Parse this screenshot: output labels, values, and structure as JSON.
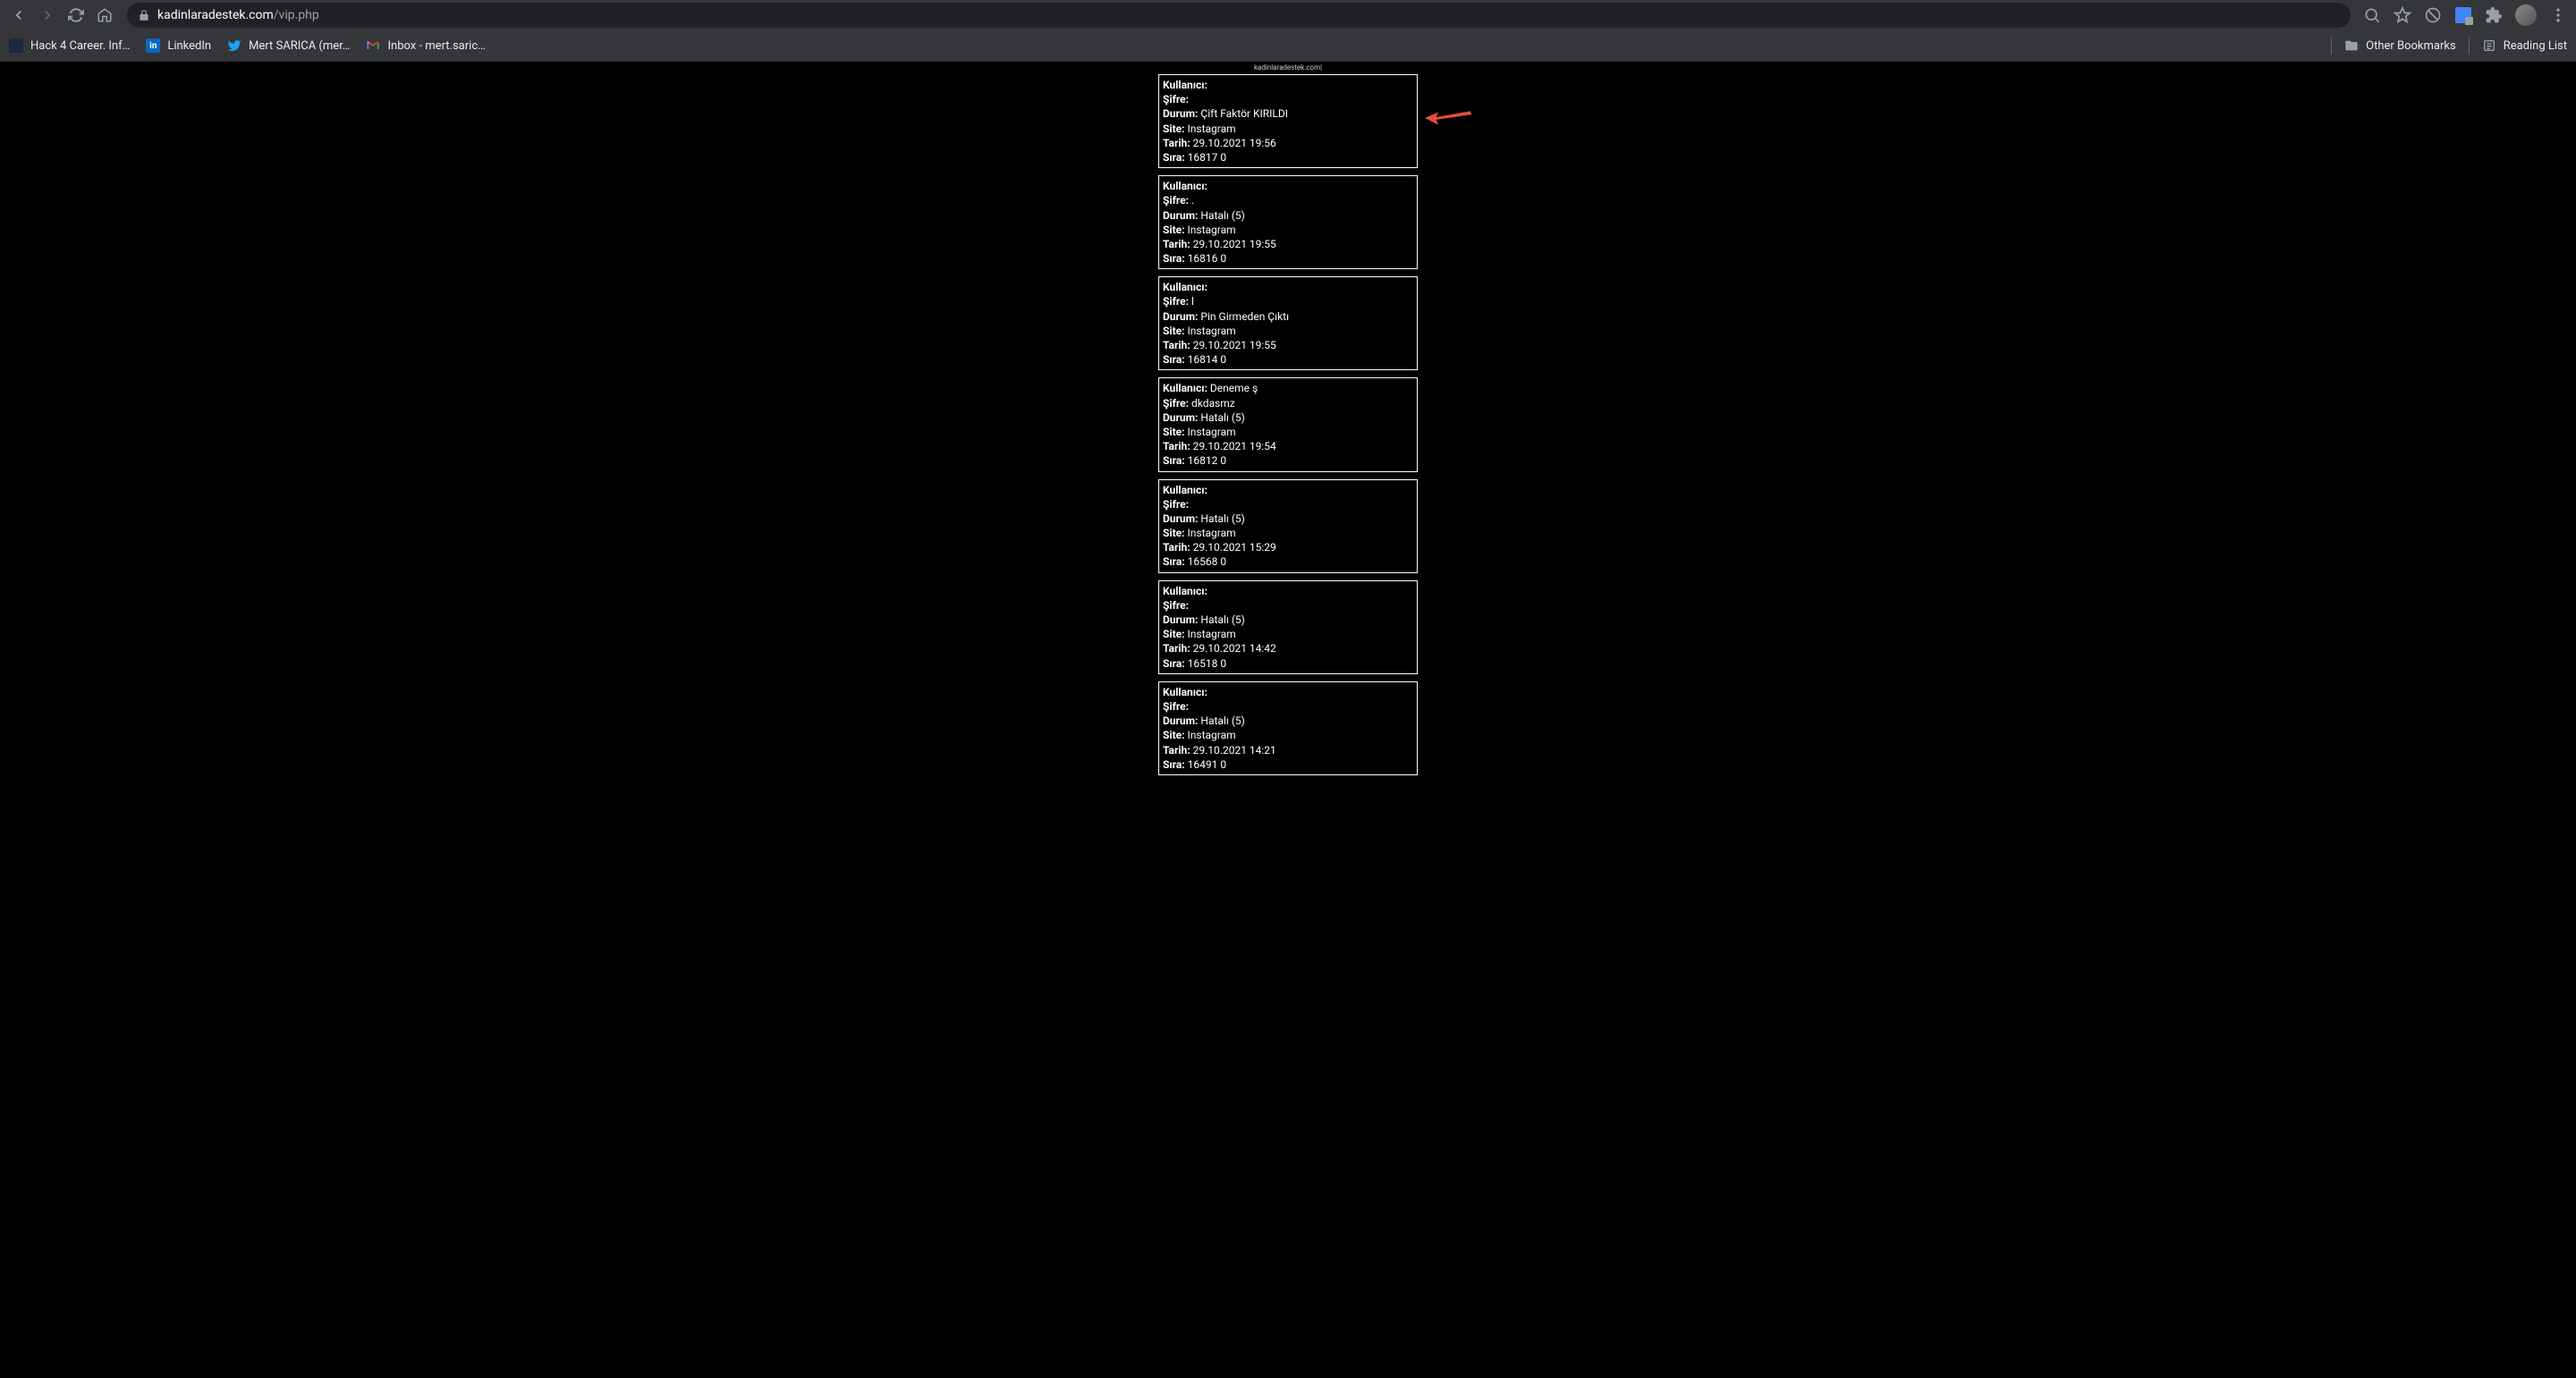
{
  "browser": {
    "url_domain": "kadinlaradestek.com",
    "url_path": "/vip.php"
  },
  "bookmarks": {
    "items": [
      {
        "label": "Hack 4 Career. Inf…"
      },
      {
        "label": "LinkedIn"
      },
      {
        "label": "Mert SARICA (mer…"
      },
      {
        "label": "Inbox - mert.saric…"
      }
    ],
    "other_bookmarks": "Other Bookmarks",
    "reading_list": "Reading List"
  },
  "page": {
    "header_text": "kadinlaradestek.com|",
    "labels": {
      "kullanici": "Kullanıcı:",
      "sifre": "Şifre:",
      "durum": "Durum:",
      "site": "Site:",
      "tarih": "Tarih:",
      "sira": "Sıra:"
    },
    "records": [
      {
        "kullanici": "",
        "kullanici_redacted": true,
        "sifre": "",
        "sifre_redacted": true,
        "durum": "Çift Faktör KIRILDI",
        "site": "Instagram",
        "tarih": "29.10.2021 19:56",
        "sira": "16817 0",
        "arrow": true
      },
      {
        "kullanici": "",
        "kullanici_redacted": true,
        "sifre": ".",
        "sifre_redacted": false,
        "durum": "Hatalı (5)",
        "site": "Instagram",
        "tarih": "29.10.2021 19:55",
        "sira": "16816 0"
      },
      {
        "kullanici": "",
        "kullanici_redacted": true,
        "sifre": "l",
        "sifre_redacted": true,
        "durum": "Pin Girmeden Çıktı",
        "site": "Instagram",
        "tarih": "29.10.2021 19:55",
        "sira": "16814 0"
      },
      {
        "kullanici": "Deneme ş",
        "kullanici_redacted": false,
        "sifre": "dkdasmz",
        "sifre_redacted": false,
        "durum": "Hatalı (5)",
        "site": "Instagram",
        "tarih": "29.10.2021 19:54",
        "sira": "16812 0"
      },
      {
        "kullanici": "",
        "kullanici_redacted": true,
        "sifre": "",
        "sifre_redacted": true,
        "durum": "Hatalı (5)",
        "site": "Instagram",
        "tarih": "29.10.2021 15:29",
        "sira": "16568 0"
      },
      {
        "kullanici": "",
        "kullanici_redacted": true,
        "sifre": "",
        "sifre_redacted": true,
        "durum": "Hatalı (5)",
        "site": "Instagram",
        "tarih": "29.10.2021 14:42",
        "sira": "16518 0"
      },
      {
        "kullanici": "",
        "kullanici_redacted": true,
        "sifre": "",
        "sifre_redacted": true,
        "durum": "Hatalı (5)",
        "site": "Instagram",
        "tarih": "29.10.2021 14:21",
        "sira": "16491 0"
      }
    ]
  }
}
